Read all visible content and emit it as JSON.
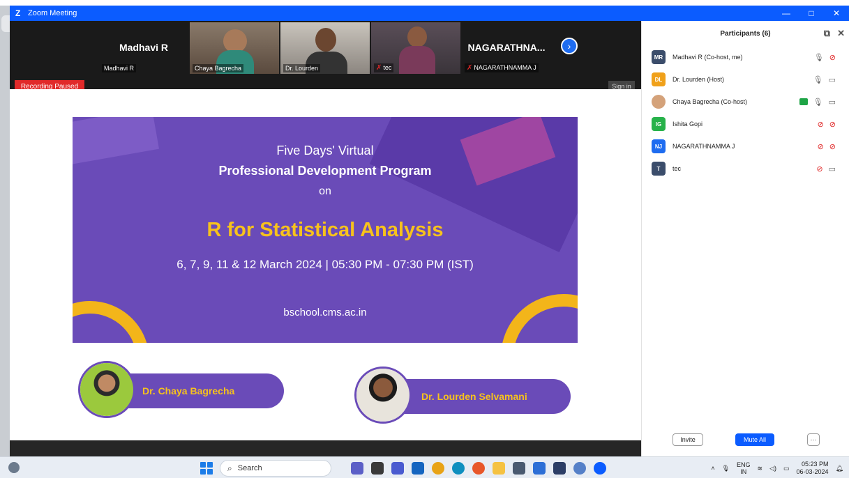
{
  "window": {
    "title": "Zoom Meeting",
    "logo": "Z",
    "controls": [
      "—",
      "□",
      "✕"
    ]
  },
  "video_strip": {
    "tiles": [
      {
        "big_name": "Madhavi R",
        "label": "Madhavi R",
        "muted": false
      },
      {
        "big_name": "",
        "label": "Chaya Bagrecha",
        "muted": false
      },
      {
        "big_name": "",
        "label": "Dr. Lourden",
        "muted": false
      },
      {
        "big_name": "",
        "label": "tec",
        "muted": true
      },
      {
        "big_name": "NAGARATHNA...",
        "label": "NAGARATHNAMMA J",
        "muted": true
      }
    ],
    "next_arrow": "›",
    "recording_status": "Recording Paused",
    "sign_in": "Sign in"
  },
  "slide": {
    "line1": "Five Days' Virtual",
    "line2": "Professional Development Program",
    "line3": "on",
    "title": "R for Statistical Analysis",
    "dates": "6, 7, 9, 11 & 12 March 2024  |  05:30 PM - 07:30 PM (IST)",
    "website": "bschool.cms.ac.in",
    "speakers": [
      {
        "name": "Dr. Chaya Bagrecha"
      },
      {
        "name": "Dr. Lourden  Selvamani"
      }
    ],
    "colors": {
      "purple": "#6a4bb8",
      "yellow": "#f7c21c"
    }
  },
  "participants": {
    "header": "Participants (6)",
    "header_icons": [
      "popout-icon",
      "close-icon"
    ],
    "list": [
      {
        "initials": "MR",
        "name": "Madhavi R (Co-host, me)",
        "color": "#3b4d6b",
        "mic": "mic-on",
        "video": "video-off"
      },
      {
        "initials": "DL",
        "name": "Dr. Lourden (Host)",
        "color": "#f0a11a",
        "mic": "mic-active",
        "video": "video-on"
      },
      {
        "initials": "",
        "name": "Chaya Bagrecha (Co-host)",
        "color": "#d4a27a",
        "mic": "mic-on",
        "video": "video-on",
        "sharing": true
      },
      {
        "initials": "IG",
        "name": "Ishita Gopi",
        "color": "#27b24a",
        "mic": "mic-off",
        "video": "video-off"
      },
      {
        "initials": "NJ",
        "name": "NAGARATHNAMMA J",
        "color": "#1e6cf0",
        "mic": "mic-off",
        "video": "video-off"
      },
      {
        "initials": "T",
        "name": "tec",
        "color": "#3b4d6b",
        "mic": "mic-off",
        "video": "video-on"
      }
    ],
    "invite_label": "Invite",
    "mute_all_label": "Mute All",
    "more_label": "···"
  },
  "taskbar": {
    "search_placeholder": "Search",
    "lang_line1": "ENG",
    "lang_line2": "IN",
    "time": "05:23 PM",
    "date": "06-03-2024",
    "apps": [
      {
        "name": "teams-icon",
        "color": "#5b5fc7"
      },
      {
        "name": "file-explorer-app-icon",
        "color": "#3a3a3a"
      },
      {
        "name": "chat-icon",
        "color": "#4a5bd0"
      },
      {
        "name": "mail-icon",
        "color": "#1565c0"
      },
      {
        "name": "chrome-icon",
        "color": "#e8a317"
      },
      {
        "name": "edge-icon",
        "color": "#0f8fbf"
      },
      {
        "name": "firefox-icon",
        "color": "#e8572a"
      },
      {
        "name": "folder-icon",
        "color": "#f5c242"
      },
      {
        "name": "calculator-icon",
        "color": "#4a5a70"
      },
      {
        "name": "notepad-icon",
        "color": "#2d6fd6"
      },
      {
        "name": "store-icon",
        "color": "#2c3e66"
      },
      {
        "name": "globe-icon",
        "color": "#5580c8"
      },
      {
        "name": "zoom-icon",
        "color": "#0b5cff"
      }
    ]
  }
}
